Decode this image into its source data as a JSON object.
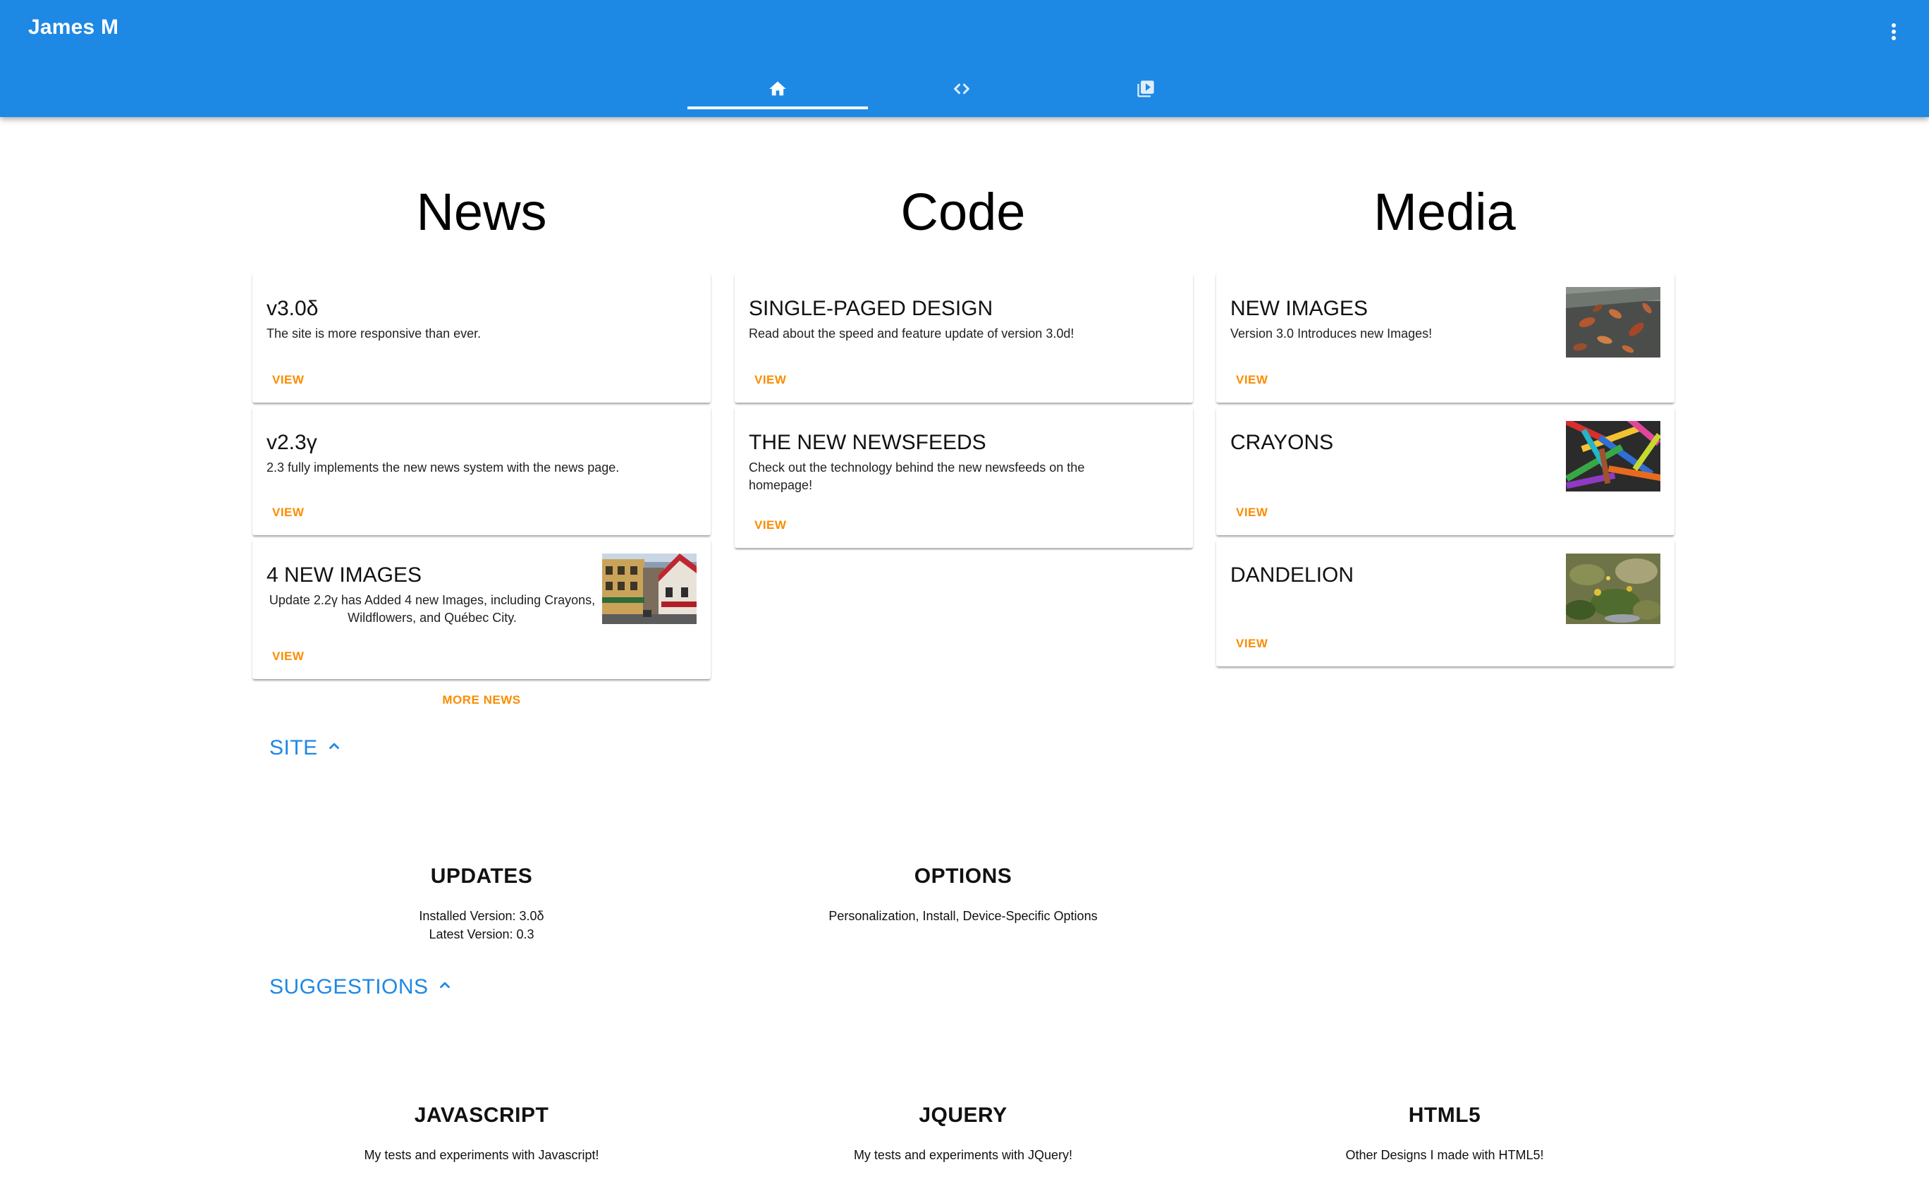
{
  "app": {
    "title": "James M"
  },
  "tabs": [
    {
      "name": "home",
      "icon": "home-icon"
    },
    {
      "name": "code",
      "icon": "code-icon"
    },
    {
      "name": "media",
      "icon": "video-library-icon"
    }
  ],
  "columns": {
    "news": {
      "heading": "News",
      "cards": [
        {
          "title": "v3.0δ",
          "subtitle": "The site is more responsive than ever.",
          "action": "VIEW"
        },
        {
          "title": "v2.3γ",
          "subtitle": "2.3 fully implements the new news system with the news page.",
          "action": "VIEW"
        },
        {
          "title": "4 NEW IMAGES",
          "subtitle": "Update 2.2γ has Added 4 new Images, including Crayons, Wildflowers, and Québec City.",
          "action": "VIEW",
          "image": "quebec-city-street"
        }
      ],
      "more": "MORE NEWS"
    },
    "code": {
      "heading": "Code",
      "cards": [
        {
          "title": "SINGLE-PAGED DESIGN",
          "subtitle": "Read about the speed and feature update of version 3.0d!",
          "action": "VIEW"
        },
        {
          "title": "THE NEW NEWSFEEDS",
          "subtitle": "Check out the technology behind the new newsfeeds on the homepage!",
          "action": "VIEW"
        }
      ]
    },
    "media": {
      "heading": "Media",
      "cards": [
        {
          "title": "NEW IMAGES",
          "subtitle": "Version 3.0 Introduces new Images!",
          "action": "VIEW",
          "image": "leaves-in-water"
        },
        {
          "title": "CRAYONS",
          "subtitle": "",
          "action": "VIEW",
          "image": "crayons"
        },
        {
          "title": "DANDELION",
          "subtitle": "",
          "action": "VIEW",
          "image": "dandelion"
        }
      ]
    }
  },
  "site": {
    "label": "SITE",
    "updates": {
      "title": "UPDATES",
      "installed": "Installed Version: 3.0δ",
      "latest": "Latest Version: 0.3"
    },
    "options": {
      "title": "OPTIONS",
      "text": "Personalization, Install, Device-Specific Options"
    }
  },
  "suggestions": {
    "label": "SUGGESTIONS",
    "items": [
      {
        "title": "JAVASCRIPT",
        "text": "My tests and experiments with Javascript!"
      },
      {
        "title": "JQUERY",
        "text": "My tests and experiments with JQuery!"
      },
      {
        "title": "HTML5",
        "text": "Other Designs I made with HTML5!"
      }
    ]
  },
  "colors": {
    "primary": "#1e88e5",
    "accent": "#fb8c00"
  }
}
